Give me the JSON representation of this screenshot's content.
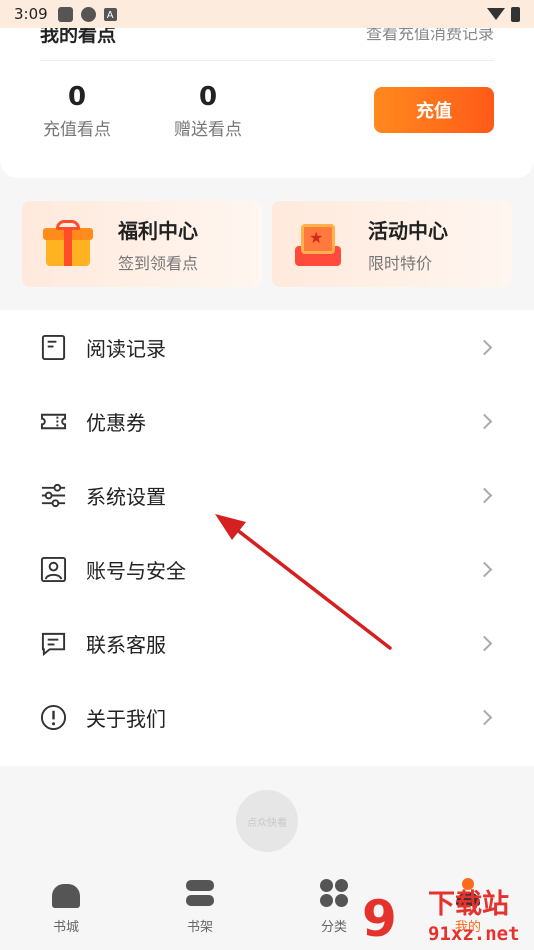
{
  "status_bar": {
    "time": "3:09",
    "icon_a_label": "A"
  },
  "account": {
    "clipped_title": "我的看点",
    "clipped_link": "查看充值消费记录",
    "recharge_points": {
      "value": "0",
      "label": "充值看点"
    },
    "gift_points": {
      "value": "0",
      "label": "赠送看点"
    },
    "recharge_button": "充值"
  },
  "promos": [
    {
      "title": "福利中心",
      "subtitle": "签到领看点",
      "icon": "gift-icon"
    },
    {
      "title": "活动中心",
      "subtitle": "限时特价",
      "icon": "event-box-icon"
    }
  ],
  "menu": [
    {
      "label": "阅读记录",
      "icon": "reading-history-icon"
    },
    {
      "label": "优惠券",
      "icon": "coupon-icon"
    },
    {
      "label": "系统设置",
      "icon": "settings-sliders-icon"
    },
    {
      "label": "账号与安全",
      "icon": "account-security-icon"
    },
    {
      "label": "联系客服",
      "icon": "customer-service-icon"
    },
    {
      "label": "关于我们",
      "icon": "about-info-icon"
    }
  ],
  "footer": {
    "logo_text": "点众快看"
  },
  "tabbar": [
    {
      "label": "书城",
      "icon": "home-icon"
    },
    {
      "label": "书架",
      "icon": "bookshelf-icon"
    },
    {
      "label": "分类",
      "icon": "category-icon"
    },
    {
      "label": "我的",
      "icon": "profile-icon",
      "active": true
    }
  ],
  "watermark": {
    "digit": "9",
    "top": "下载站",
    "bottom": "91xz.net"
  },
  "colors": {
    "accent": "#ff6a1a",
    "button_start": "#ff8a1e",
    "button_end": "#ff5a18",
    "arrow": "#d42020",
    "watermark": "#e5322d"
  }
}
